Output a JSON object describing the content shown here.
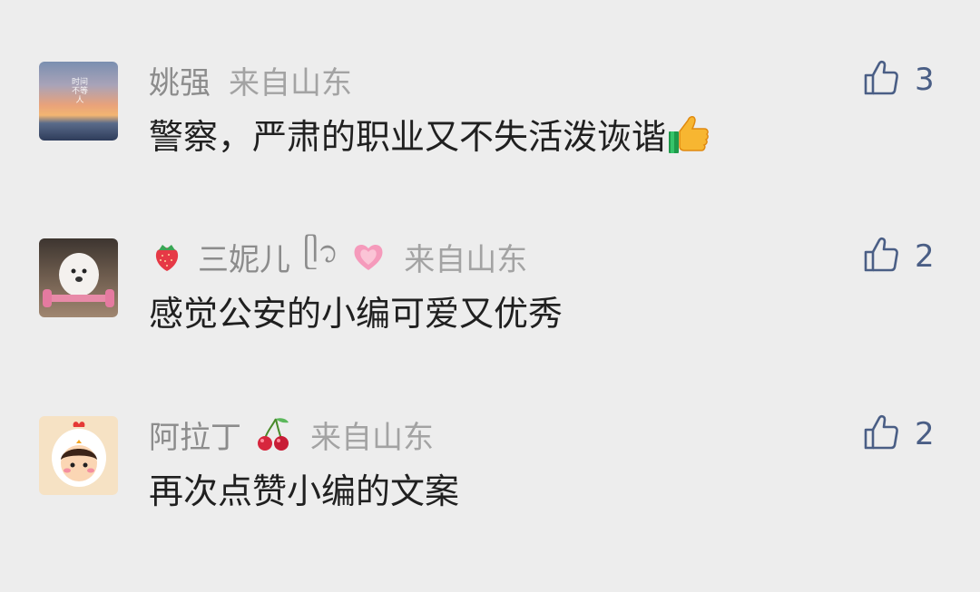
{
  "comments": [
    {
      "user": "姚强",
      "location": "来自山东",
      "text": "警察，严肃的职业又不失活泼诙谐",
      "likes": "3",
      "avatar_text": "时间不等人",
      "name_emoji": [],
      "text_emoji": "thumbs-up-icon"
    },
    {
      "user": "三妮儿",
      "name_decoration": "ᥫ᭡",
      "location": "来自山东",
      "text": "感觉公安的小编可爱又优秀",
      "likes": "2",
      "name_emoji": [
        "strawberry-icon",
        "heart-icon"
      ]
    },
    {
      "user": "阿拉丁",
      "location": "来自山东",
      "text": "再次点赞小编的文案",
      "likes": "2",
      "name_emoji": [
        "cherry-icon"
      ]
    }
  ],
  "colors": {
    "background": "#ededed",
    "name": "#8c8c8c",
    "location": "#a3a3a3",
    "text": "#202020",
    "like": "#4a5e85"
  }
}
